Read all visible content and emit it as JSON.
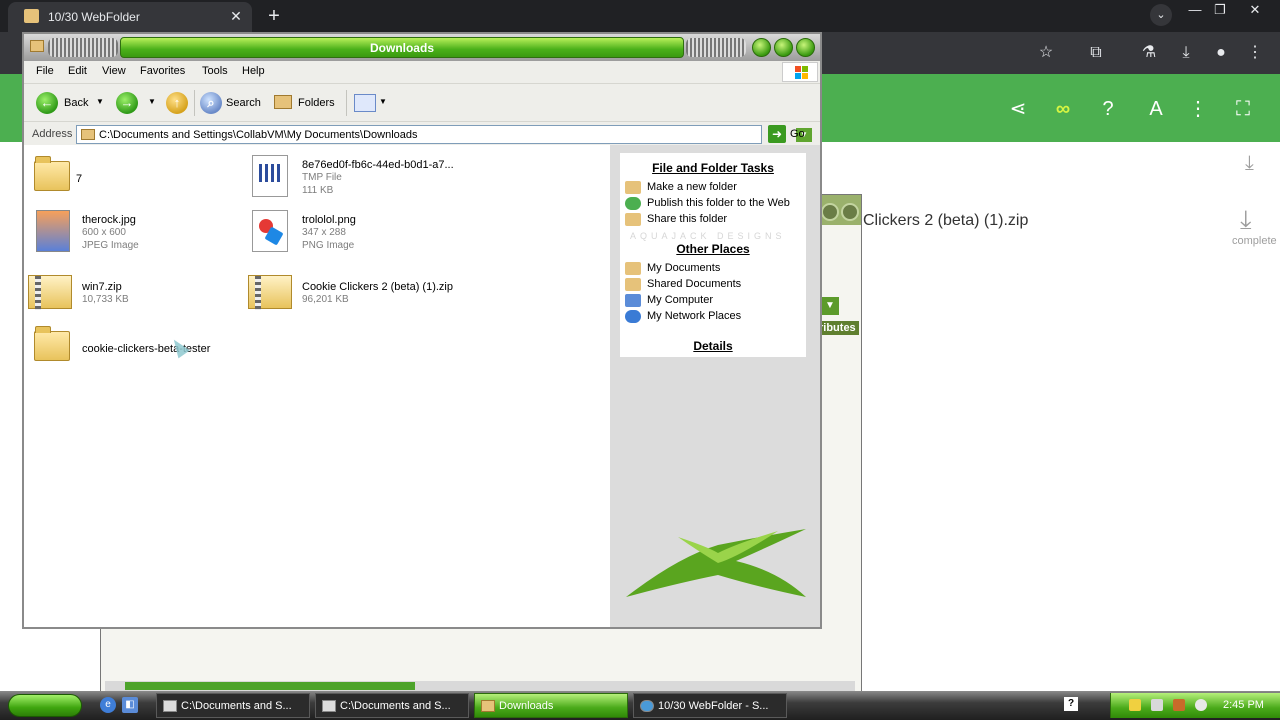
{
  "browser": {
    "tab_title": "10/30 WebFolder",
    "tab_close": "✕",
    "new_tab": "+",
    "tab_menu": "⌄",
    "window_controls": [
      "—",
      "❐",
      "✕"
    ],
    "toolbar_icons": [
      "star-icon",
      "extensions-icon",
      "labs-icon",
      "download-icon",
      "profile-icon",
      "kebab-menu-icon"
    ]
  },
  "app_bar": {
    "icons": [
      "share-icon",
      "loop-icon",
      "help-icon",
      "translate-icon",
      "more-icon",
      "fullscreen-icon"
    ]
  },
  "download_panel": {
    "filename": "Clickers 2 (beta) (1).zip",
    "status": "complete"
  },
  "explorer": {
    "title": "Downloads",
    "menu": [
      "File",
      "Edit",
      "View",
      "Favorites",
      "Tools",
      "Help"
    ],
    "toolbar": {
      "back": "Back",
      "search": "Search",
      "folders": "Folders"
    },
    "address": {
      "label": "Address",
      "path": "C:\\Documents and Settings\\CollabVM\\My Documents\\Downloads",
      "go": "Go"
    },
    "files": [
      {
        "name": "7",
        "type": "folder",
        "meta1": "",
        "meta2": ""
      },
      {
        "name": "8e76ed0f-fb6c-44ed-b0d1-a7...",
        "type": "tmp",
        "meta1": "TMP File",
        "meta2": "111 KB"
      },
      {
        "name": "therock.jpg",
        "type": "jpg",
        "meta1": "600 x 600",
        "meta2": "JPEG Image"
      },
      {
        "name": "trololol.png",
        "type": "png",
        "meta1": "347 x 288",
        "meta2": "PNG Image"
      },
      {
        "name": "win7.zip",
        "type": "zip",
        "meta1": "10,733 KB",
        "meta2": ""
      },
      {
        "name": "Cookie Clickers 2 (beta) (1).zip",
        "type": "zip",
        "meta1": "96,201 KB",
        "meta2": ""
      },
      {
        "name": "cookie-clickers-beta-tester",
        "type": "folder",
        "meta1": "",
        "meta2": ""
      }
    ],
    "tasks": {
      "file_folder_heading": "File and Folder Tasks",
      "file_folder_links": [
        "Make a new folder",
        "Publish this folder to the Web",
        "Share this folder"
      ],
      "other_places_heading": "Other Places",
      "other_places_links": [
        "My Documents",
        "Shared Documents",
        "My Computer",
        "My Network Places"
      ],
      "details_heading": "Details"
    },
    "logo_text": "AQUAJACK DESIGNS"
  },
  "background_window": {
    "attr_label": "ributes"
  },
  "taskbar": {
    "buttons": [
      {
        "label": "C:\\Documents and S...",
        "active": false
      },
      {
        "label": "C:\\Documents and S...",
        "active": false
      },
      {
        "label": "Downloads",
        "active": true
      },
      {
        "label": "10/30 WebFolder - S...",
        "active": false
      }
    ],
    "time": "2:45 PM"
  },
  "colors": {
    "accent_green": "#4caf50",
    "xp_green": "#4ab01a"
  }
}
